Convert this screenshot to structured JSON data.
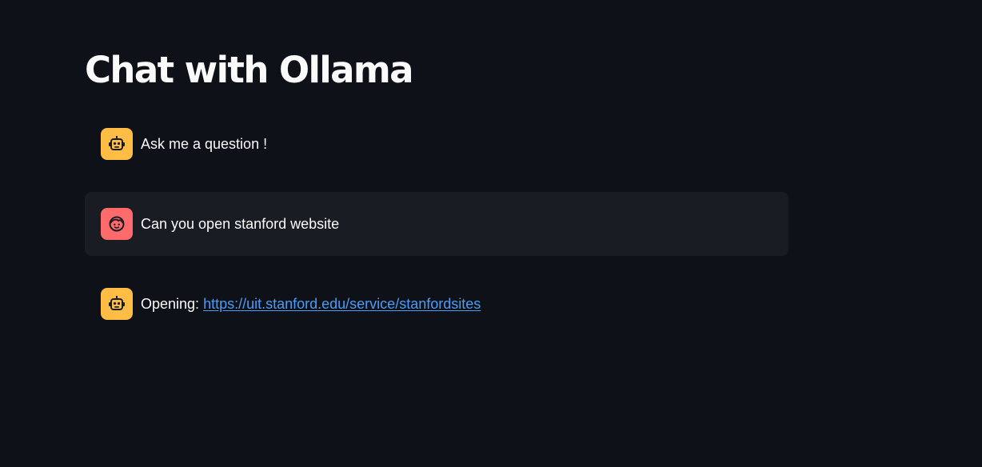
{
  "page": {
    "title": "Chat with Ollama"
  },
  "colors": {
    "background": "#0e1117",
    "user_message_background": "#1a1c24",
    "assistant_avatar": "#ffbd45",
    "user_avatar": "#ff6b6b",
    "link": "#4a9cf6",
    "text": "#fafafa"
  },
  "messages": [
    {
      "role": "assistant",
      "avatar_icon": "robot-face-icon",
      "text": "Ask me a question !"
    },
    {
      "role": "user",
      "avatar_icon": "person-face-icon",
      "text": "Can you open stanford website"
    },
    {
      "role": "assistant",
      "avatar_icon": "robot-face-icon",
      "prefix": "Opening: ",
      "link_text": "https://uit.stanford.edu/service/stanfordsites"
    }
  ]
}
